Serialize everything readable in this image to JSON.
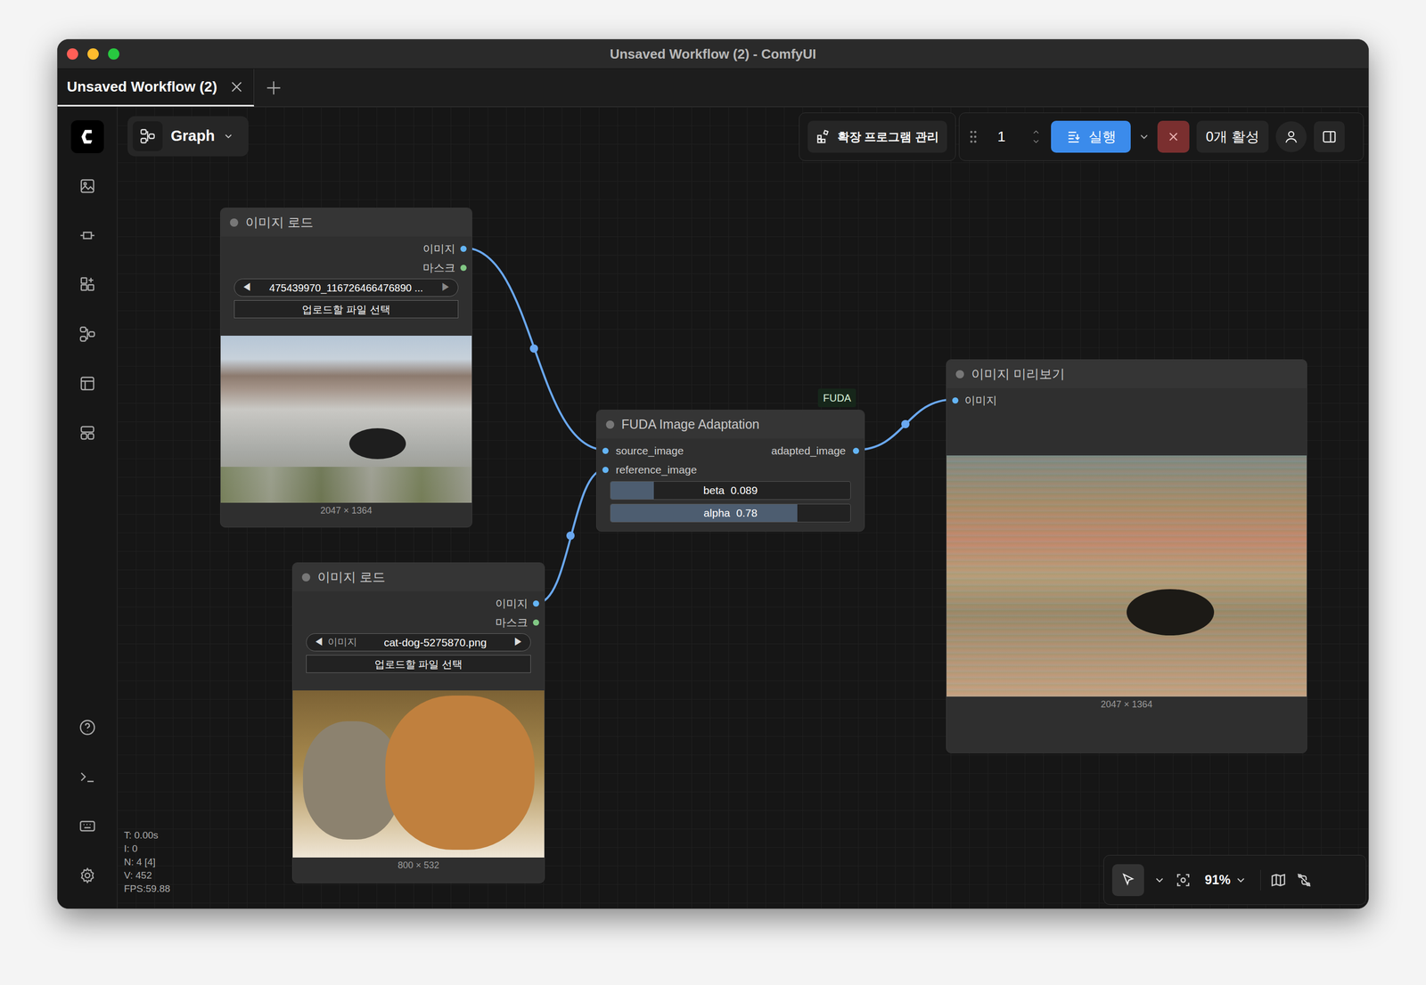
{
  "window": {
    "title": "Unsaved Workflow (2) - ComfyUI"
  },
  "tabs": [
    {
      "label": "Unsaved Workflow (2)",
      "selected": true
    }
  ],
  "toolbar": {
    "view": "Graph",
    "extensions": "확장 프로그램 관리",
    "queue_count": "1",
    "run": "실행",
    "active": "0개 활성"
  },
  "nodes": {
    "load_image_1": {
      "title": "이미지 로드",
      "outputs": [
        "이미지",
        "마스크"
      ],
      "combo": {
        "prev": "◀",
        "value": "475439970_116726466476890 ...",
        "next": "▶"
      },
      "upload": "업로드할 파일 선택",
      "size": "2047 × 1364"
    },
    "load_image_2": {
      "title": "이미지 로드",
      "outputs": [
        "이미지",
        "마스크"
      ],
      "combo": {
        "prev": "◀",
        "label": "이미지",
        "value": "cat-dog-5275870.png",
        "next": "▶"
      },
      "upload": "업로드할 파일 선택",
      "size": "800 × 532"
    },
    "fuda": {
      "badge": "FUDA",
      "title": "FUDA Image Adaptation",
      "inputs": [
        "source_image",
        "reference_image"
      ],
      "outputs": [
        "adapted_image"
      ],
      "widgets": [
        {
          "label": "beta",
          "value": "0.089",
          "level": 0.18
        },
        {
          "label": "alpha",
          "value": "0.78",
          "level": 0.78
        }
      ]
    },
    "preview": {
      "title": "이미지 미리보기",
      "inputs": [
        "이미지"
      ],
      "size": "2047 × 1364"
    }
  },
  "stats": [
    "T: 0.00s",
    "I: 0",
    "N: 4 [4]",
    "V: 452",
    "FPS:59.88"
  ],
  "canvas_controls": {
    "zoom": "91%",
    "pointer_selected": true
  }
}
